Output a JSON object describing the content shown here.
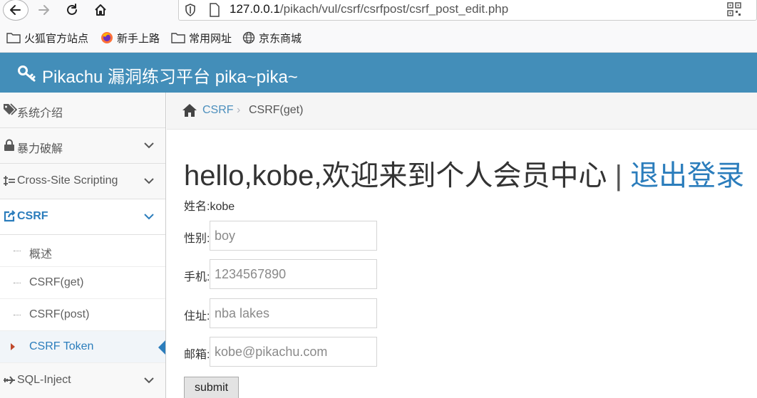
{
  "browser": {
    "url_host": "127.0.0.1",
    "url_path": "/pikach/vul/csrf/csrfpost/csrf_post_edit.php"
  },
  "bookmarks": [
    {
      "label": "火狐官方站点",
      "icon": "folder-icon"
    },
    {
      "label": "新手上路",
      "icon": "firefox-icon"
    },
    {
      "label": "常用网址",
      "icon": "folder-icon"
    },
    {
      "label": "京东商城",
      "icon": "globe-icon"
    }
  ],
  "app": {
    "brand": "Pikachu 漏洞练习平台 pika~pika~",
    "accent": "#438eb9"
  },
  "sidebar": {
    "items": [
      {
        "label": "系统介绍",
        "icon": "tags-icon"
      },
      {
        "label": "暴力破解",
        "icon": "lock-icon"
      },
      {
        "label": "Cross-Site Scripting",
        "icon": "list-icon"
      },
      {
        "label": "CSRF",
        "icon": "share-icon"
      },
      {
        "label": "SQL-Inject",
        "icon": "plane-icon"
      }
    ],
    "sub_items": [
      {
        "label": "概述"
      },
      {
        "label": "CSRF(get)"
      },
      {
        "label": "CSRF(post)"
      },
      {
        "label": "CSRF Token"
      }
    ]
  },
  "breadcrumbs": {
    "link": "CSRF",
    "separator": "›",
    "current": "CSRF(get)"
  },
  "main": {
    "greeting": "hello,kobe,欢迎来到个人会员中心",
    "separator": "|",
    "logout": "退出登录",
    "name_label": "姓名:kobe",
    "fields": [
      {
        "label": "性别:",
        "placeholder": "boy"
      },
      {
        "label": "手机:",
        "placeholder": "1234567890"
      },
      {
        "label": "住址:",
        "placeholder": "nba lakes"
      },
      {
        "label": "邮箱:",
        "placeholder": "kobe@pikachu.com"
      }
    ],
    "submit": "submit"
  }
}
